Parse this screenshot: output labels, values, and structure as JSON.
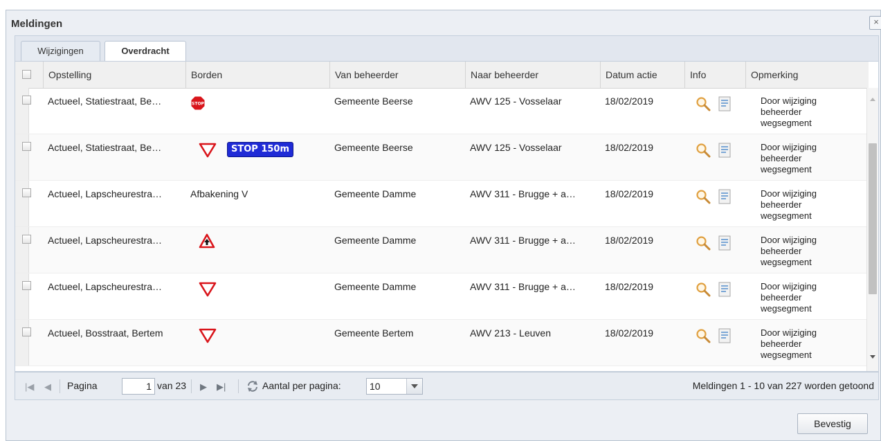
{
  "window": {
    "title": "Meldingen",
    "close_label": "×"
  },
  "tabs": [
    {
      "label": "Wijzigingen"
    },
    {
      "label": "Overdracht"
    }
  ],
  "columns": {
    "opstelling": "Opstelling",
    "borden": "Borden",
    "van": "Van beheerder",
    "naar": "Naar beheerder",
    "datum": "Datum actie",
    "info": "Info",
    "opmerking": "Opmerking"
  },
  "rows": [
    {
      "opstelling": "Actueel, Statiestraat, Be…",
      "borden_text": "",
      "van": "Gemeente Beerse",
      "naar": "AWV 125 - Vosselaar",
      "datum": "18/02/2019",
      "opm_1": "Door wijziging",
      "opm_2": "beheerder",
      "opm_3": "wegsegment"
    },
    {
      "opstelling": "Actueel, Statiestraat, Be…",
      "borden_text": "STOP 150m",
      "van": "Gemeente Beerse",
      "naar": "AWV 125 - Vosselaar",
      "datum": "18/02/2019",
      "opm_1": "Door wijziging",
      "opm_2": "beheerder",
      "opm_3": "wegsegment"
    },
    {
      "opstelling": "Actueel, Lapscheurestra…",
      "borden_text": "Afbakening V",
      "van": "Gemeente Damme",
      "naar": "AWV 311 - Brugge + a…",
      "datum": "18/02/2019",
      "opm_1": "Door wijziging",
      "opm_2": "beheerder",
      "opm_3": "wegsegment"
    },
    {
      "opstelling": "Actueel, Lapscheurestra…",
      "borden_text": "",
      "van": "Gemeente Damme",
      "naar": "AWV 311 - Brugge + a…",
      "datum": "18/02/2019",
      "opm_1": "Door wijziging",
      "opm_2": "beheerder",
      "opm_3": "wegsegment"
    },
    {
      "opstelling": "Actueel, Lapscheurestra…",
      "borden_text": "",
      "van": "Gemeente Damme",
      "naar": "AWV 311 - Brugge + a…",
      "datum": "18/02/2019",
      "opm_1": "Door wijziging",
      "opm_2": "beheerder",
      "opm_3": "wegsegment"
    },
    {
      "opstelling": "Actueel, Bosstraat, Bertem",
      "borden_text": "",
      "van": "Gemeente Bertem",
      "naar": "AWV 213 - Leuven",
      "datum": "18/02/2019",
      "opm_1": "Door wijziging",
      "opm_2": "beheerder",
      "opm_3": "wegsegment"
    }
  ],
  "signs": {
    "stop_text": "STOP"
  },
  "pager": {
    "pagina_label": "Pagina",
    "page_value": "1",
    "van_label": "van 23",
    "per_page_label": "Aantal per pagina:",
    "per_page_value": "10",
    "status": "Meldingen 1 - 10 van 227 worden getoond"
  },
  "footer": {
    "confirm_label": "Bevestig"
  },
  "colors": {
    "stop_red": "#d9151b",
    "sign_blue": "#1f2bd6",
    "accent": "#c5cfdc"
  }
}
